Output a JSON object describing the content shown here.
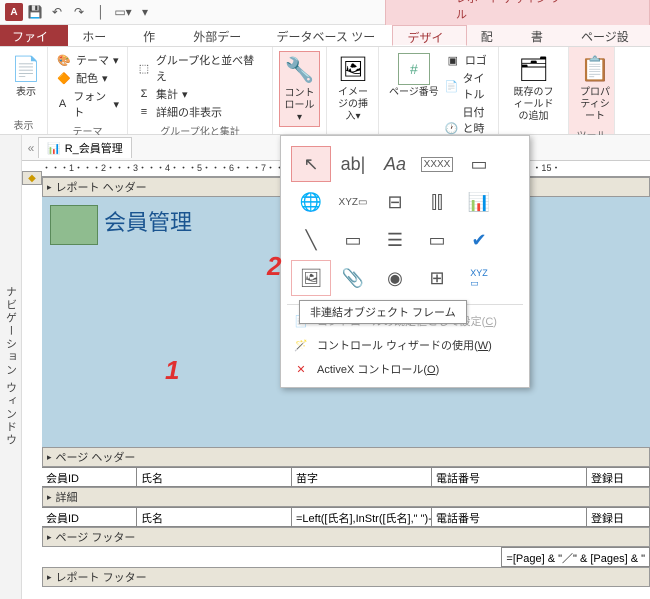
{
  "context_tab": "レポート デザイン ツール",
  "tabs": {
    "file": "ファイル",
    "home": "ホーム",
    "create": "作成",
    "external": "外部データ",
    "dbtools": "データベース ツール",
    "design": "デザイン",
    "arrange": "配置",
    "format": "書式",
    "pagesetup": "ページ設定"
  },
  "ribbon": {
    "view": "表示",
    "view_group": "表示",
    "theme": "テーマ",
    "colors": "配色",
    "fonts": "フォント",
    "theme_group": "テーマ",
    "group_sort": "グループ化と並べ替え",
    "totals": "集計",
    "hide_details": "詳細の非表示",
    "group_totals_group": "グループ化と集計",
    "controls": "コントロール",
    "insert_image": "イメージの挿入",
    "page_number": "ページ番号",
    "logo": "ロゴ",
    "title": "タイトル",
    "datetime": "日付と時刻",
    "existing_fields": "既存のフィールドの追加",
    "property_sheet": "プロパティシート",
    "tools_group": "ツール"
  },
  "navpane": "ナビゲーション ウィンドウ",
  "report_tab": "R_会員管理",
  "ruler_h": "・・・1・・・2・・・3・・・4・・・5・・・6・・・7・・・8・・・9・・・10・・・11・・・12・・・13・・・14・・・15・",
  "sections": {
    "report_header": "レポート ヘッダー",
    "page_header": "ページ ヘッダー",
    "detail": "詳細",
    "page_footer": "ページ フッター",
    "report_footer": "レポート フッター"
  },
  "report_title": "会員管理",
  "page_header_fields": [
    "会員ID",
    "氏名",
    "苗字",
    "電話番号",
    "登録日"
  ],
  "detail_fields": [
    "会員ID",
    "氏名",
    "=Left([氏名],InStr([氏名],\" \")-1)",
    "電話番号",
    "登録日"
  ],
  "page_footer_expr": "=[Page] & \"／\" & [Pages] & \"",
  "controls_popup": {
    "tooltip": "非連結オブジェクト フレーム",
    "set_default": "コントロールの既定値として設定",
    "set_default_key": "C",
    "use_wizard": "コントロール ウィザードの使用",
    "use_wizard_key": "W",
    "activex": "ActiveX コントロール",
    "activex_key": "O"
  },
  "annotations": {
    "one": "1",
    "two": "2"
  }
}
